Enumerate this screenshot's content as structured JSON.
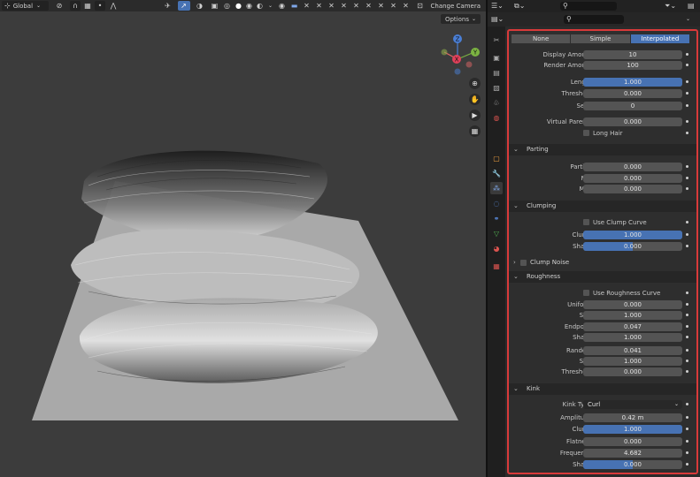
{
  "viewport_header": {
    "orientation": "Global",
    "change_camera": "Change Camera",
    "options": "Options"
  },
  "gizmo": {
    "x": "X",
    "y": "Y",
    "z": "Z"
  },
  "props_header": {
    "search_placeholder": ""
  },
  "children_mode": {
    "options": [
      "None",
      "Simple",
      "Interpolated"
    ],
    "selected": "Interpolated"
  },
  "fields": {
    "display_amount": {
      "label": "Display Amount",
      "value": "10"
    },
    "render_amount": {
      "label": "Render Amount",
      "value": "100"
    },
    "length": {
      "label": "Length",
      "value": "1.000",
      "fraction": 1.0
    },
    "threshold": {
      "label": "Threshold",
      "value": "0.000"
    },
    "seed": {
      "label": "Seed",
      "value": "0"
    },
    "virtual_parents": {
      "label": "Virtual Parents",
      "value": "0.000"
    },
    "long_hair": {
      "label": "Long Hair"
    }
  },
  "parting": {
    "title": "Parting",
    "parting": {
      "label": "Parting",
      "value": "0.000"
    },
    "min": {
      "label": "Min",
      "value": "0.000"
    },
    "max": {
      "label": "Max",
      "value": "0.000"
    }
  },
  "clumping": {
    "title": "Clumping",
    "use_curve": "Use Clump Curve",
    "clump": {
      "label": "Clump",
      "value": "1.000",
      "fraction": 1.0
    },
    "shape": {
      "label": "Shape",
      "value": "0.000",
      "fraction": 0.5
    }
  },
  "clump_noise": {
    "title": "Clump Noise"
  },
  "roughness": {
    "title": "Roughness",
    "use_curve": "Use Roughness Curve",
    "uniform": {
      "label": "Uniform",
      "value": "0.000"
    },
    "size": {
      "label": "Size",
      "value": "1.000"
    },
    "endpoint": {
      "label": "Endpoint",
      "value": "0.047"
    },
    "shape": {
      "label": "Shape",
      "value": "1.000"
    },
    "random": {
      "label": "Random",
      "value": "0.041"
    },
    "size2": {
      "label": "Size",
      "value": "1.000"
    },
    "threshold": {
      "label": "Threshold",
      "value": "0.000"
    }
  },
  "kink": {
    "title": "Kink",
    "kink_type": {
      "label": "Kink Type",
      "value": "Curl"
    },
    "amplitude": {
      "label": "Amplitude",
      "value": "0.42 m"
    },
    "clump": {
      "label": "Clump",
      "value": "1.000",
      "fraction": 1.0
    },
    "flatness": {
      "label": "Flatness",
      "value": "0.000"
    },
    "frequency": {
      "label": "Frequency",
      "value": "4.682"
    },
    "shape": {
      "label": "Shape",
      "value": "0.000",
      "fraction": 0.5
    }
  },
  "colors": {
    "accent": "#4772b3",
    "highlight_border": "#d93a3a"
  }
}
